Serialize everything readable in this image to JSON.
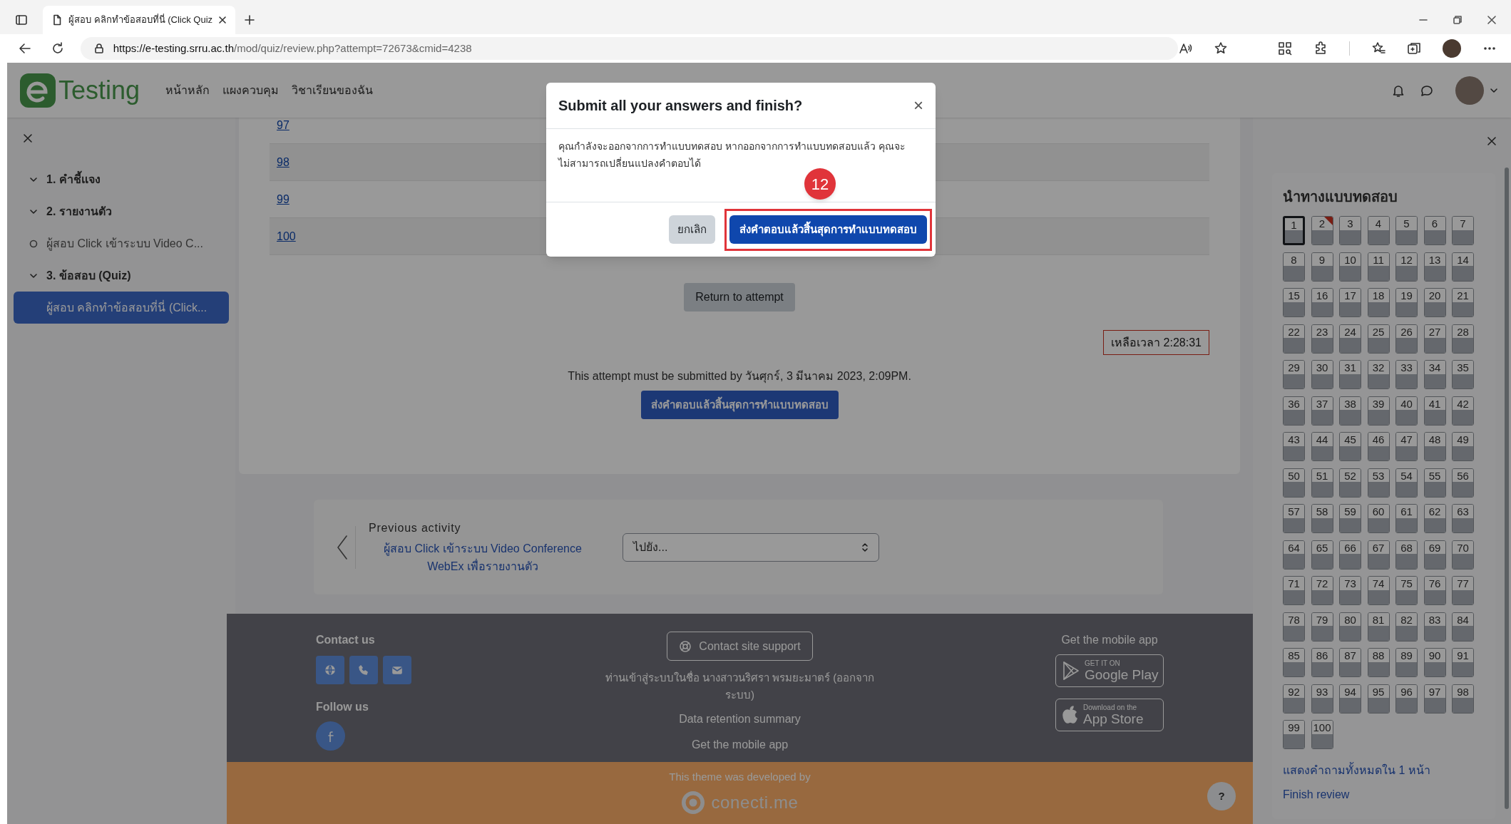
{
  "browser": {
    "tab_title": "ผู้สอบ คลิกทำข้อสอบที่นี่ (Click Quiz",
    "url_host": "https://e-testing.srru.ac.th",
    "url_path": "/mod/quiz/review.php?attempt=72673&cmid=4238"
  },
  "header": {
    "logo_text": "Testing",
    "nav": [
      "หน้าหลัก",
      "แผงควบคุม",
      "วิชาเรียนของฉัน"
    ]
  },
  "sidebar": {
    "items": [
      {
        "kind": "section",
        "label": "1. คำชี้แจง",
        "expanded": true,
        "selected": false
      },
      {
        "kind": "section",
        "label": "2. รายงานตัว",
        "expanded": true,
        "selected": false
      },
      {
        "kind": "activity",
        "label": "ผู้สอบ Click เข้าระบบ Video C...",
        "selected": false
      },
      {
        "kind": "section",
        "label": "3. ข้อสอบ (Quiz)",
        "expanded": true,
        "selected": false
      },
      {
        "kind": "activity",
        "label": "ผู้สอบ คลิกทำข้อสอบที่นี่ (Click...",
        "selected": true
      }
    ]
  },
  "review": {
    "question_links": [
      "97",
      "98",
      "99",
      "100"
    ],
    "return_button": "Return to attempt",
    "timer": "เหลือเวลา 2:28:31",
    "deadline_text": "This attempt must be submitted by วันศุกร์, 3 มีนาคม 2023, 2:09PM.",
    "submit_button": "ส่งคำตอบแล้วสิ้นสุดการทำแบบทดสอบ"
  },
  "activity_nav": {
    "label": "Previous activity",
    "link": "ผู้สอบ Click เข้าระบบ Video Conference WebEx เพื่อรายงานตัว",
    "jump_select": {
      "value": "ไปยัง..."
    }
  },
  "footer": {
    "contact_heading": "Contact us",
    "follow_heading": "Follow us",
    "support_button": "Contact site support",
    "login_info": "ท่านเข้าสู่ระบบในชื่อ นางสาวนริศรา พรมยะมาตร์ (ออกจากระบบ)",
    "links": [
      "Data retention summary",
      "Get the mobile app"
    ],
    "app_heading": "Get the mobile app",
    "store_badges": [
      {
        "kind": "google",
        "small": "GET IT ON",
        "big": "Google Play"
      },
      {
        "kind": "apple",
        "small": "Download on the",
        "big": "App Store"
      }
    ],
    "theme_credit": "This theme was developed by",
    "brand": "conecti.me",
    "help_button": "?"
  },
  "quiz_nav": {
    "title": "นำทางแบบทดสอบ",
    "questions": [
      {
        "label": "1",
        "selected": true,
        "flagged": false
      },
      {
        "label": "2",
        "selected": false,
        "flagged": true
      },
      {
        "label": "3",
        "selected": false,
        "flagged": false
      },
      {
        "label": "4",
        "selected": false,
        "flagged": false
      },
      {
        "label": "5",
        "selected": false,
        "flagged": false
      },
      {
        "label": "6",
        "selected": false,
        "flagged": false
      },
      {
        "label": "7",
        "selected": false,
        "flagged": false
      },
      {
        "label": "8",
        "selected": false,
        "flagged": false
      },
      {
        "label": "9",
        "selected": false,
        "flagged": false
      },
      {
        "label": "10",
        "selected": false,
        "flagged": false
      },
      {
        "label": "11",
        "selected": false,
        "flagged": false
      },
      {
        "label": "12",
        "selected": false,
        "flagged": false
      },
      {
        "label": "13",
        "selected": false,
        "flagged": false
      },
      {
        "label": "14",
        "selected": false,
        "flagged": false
      },
      {
        "label": "15",
        "selected": false,
        "flagged": false
      },
      {
        "label": "16",
        "selected": false,
        "flagged": false
      },
      {
        "label": "17",
        "selected": false,
        "flagged": false
      },
      {
        "label": "18",
        "selected": false,
        "flagged": false
      },
      {
        "label": "19",
        "selected": false,
        "flagged": false
      },
      {
        "label": "20",
        "selected": false,
        "flagged": false
      },
      {
        "label": "21",
        "selected": false,
        "flagged": false
      },
      {
        "label": "22",
        "selected": false,
        "flagged": false
      },
      {
        "label": "23",
        "selected": false,
        "flagged": false
      },
      {
        "label": "24",
        "selected": false,
        "flagged": false
      },
      {
        "label": "25",
        "selected": false,
        "flagged": false
      },
      {
        "label": "26",
        "selected": false,
        "flagged": false
      },
      {
        "label": "27",
        "selected": false,
        "flagged": false
      },
      {
        "label": "28",
        "selected": false,
        "flagged": false
      },
      {
        "label": "29",
        "selected": false,
        "flagged": false
      },
      {
        "label": "30",
        "selected": false,
        "flagged": false
      },
      {
        "label": "31",
        "selected": false,
        "flagged": false
      },
      {
        "label": "32",
        "selected": false,
        "flagged": false
      },
      {
        "label": "33",
        "selected": false,
        "flagged": false
      },
      {
        "label": "34",
        "selected": false,
        "flagged": false
      },
      {
        "label": "35",
        "selected": false,
        "flagged": false
      },
      {
        "label": "36",
        "selected": false,
        "flagged": false
      },
      {
        "label": "37",
        "selected": false,
        "flagged": false
      },
      {
        "label": "38",
        "selected": false,
        "flagged": false
      },
      {
        "label": "39",
        "selected": false,
        "flagged": false
      },
      {
        "label": "40",
        "selected": false,
        "flagged": false
      },
      {
        "label": "41",
        "selected": false,
        "flagged": false
      },
      {
        "label": "42",
        "selected": false,
        "flagged": false
      },
      {
        "label": "43",
        "selected": false,
        "flagged": false
      },
      {
        "label": "44",
        "selected": false,
        "flagged": false
      },
      {
        "label": "45",
        "selected": false,
        "flagged": false
      },
      {
        "label": "46",
        "selected": false,
        "flagged": false
      },
      {
        "label": "47",
        "selected": false,
        "flagged": false
      },
      {
        "label": "48",
        "selected": false,
        "flagged": false
      },
      {
        "label": "49",
        "selected": false,
        "flagged": false
      },
      {
        "label": "50",
        "selected": false,
        "flagged": false
      },
      {
        "label": "51",
        "selected": false,
        "flagged": false
      },
      {
        "label": "52",
        "selected": false,
        "flagged": false
      },
      {
        "label": "53",
        "selected": false,
        "flagged": false
      },
      {
        "label": "54",
        "selected": false,
        "flagged": false
      },
      {
        "label": "55",
        "selected": false,
        "flagged": false
      },
      {
        "label": "56",
        "selected": false,
        "flagged": false
      },
      {
        "label": "57",
        "selected": false,
        "flagged": false
      },
      {
        "label": "58",
        "selected": false,
        "flagged": false
      },
      {
        "label": "59",
        "selected": false,
        "flagged": false
      },
      {
        "label": "60",
        "selected": false,
        "flagged": false
      },
      {
        "label": "61",
        "selected": false,
        "flagged": false
      },
      {
        "label": "62",
        "selected": false,
        "flagged": false
      },
      {
        "label": "63",
        "selected": false,
        "flagged": false
      },
      {
        "label": "64",
        "selected": false,
        "flagged": false
      },
      {
        "label": "65",
        "selected": false,
        "flagged": false
      },
      {
        "label": "66",
        "selected": false,
        "flagged": false
      },
      {
        "label": "67",
        "selected": false,
        "flagged": false
      },
      {
        "label": "68",
        "selected": false,
        "flagged": false
      },
      {
        "label": "69",
        "selected": false,
        "flagged": false
      },
      {
        "label": "70",
        "selected": false,
        "flagged": false
      },
      {
        "label": "71",
        "selected": false,
        "flagged": false
      },
      {
        "label": "72",
        "selected": false,
        "flagged": false
      },
      {
        "label": "73",
        "selected": false,
        "flagged": false
      },
      {
        "label": "74",
        "selected": false,
        "flagged": false
      },
      {
        "label": "75",
        "selected": false,
        "flagged": false
      },
      {
        "label": "76",
        "selected": false,
        "flagged": false
      },
      {
        "label": "77",
        "selected": false,
        "flagged": false
      },
      {
        "label": "78",
        "selected": false,
        "flagged": false
      },
      {
        "label": "79",
        "selected": false,
        "flagged": false
      },
      {
        "label": "80",
        "selected": false,
        "flagged": false
      },
      {
        "label": "81",
        "selected": false,
        "flagged": false
      },
      {
        "label": "82",
        "selected": false,
        "flagged": false
      },
      {
        "label": "83",
        "selected": false,
        "flagged": false
      },
      {
        "label": "84",
        "selected": false,
        "flagged": false
      },
      {
        "label": "85",
        "selected": false,
        "flagged": false
      },
      {
        "label": "86",
        "selected": false,
        "flagged": false
      },
      {
        "label": "87",
        "selected": false,
        "flagged": false
      },
      {
        "label": "88",
        "selected": false,
        "flagged": false
      },
      {
        "label": "89",
        "selected": false,
        "flagged": false
      },
      {
        "label": "90",
        "selected": false,
        "flagged": false
      },
      {
        "label": "91",
        "selected": false,
        "flagged": false
      },
      {
        "label": "92",
        "selected": false,
        "flagged": false
      },
      {
        "label": "93",
        "selected": false,
        "flagged": false
      },
      {
        "label": "94",
        "selected": false,
        "flagged": false
      },
      {
        "label": "95",
        "selected": false,
        "flagged": false
      },
      {
        "label": "96",
        "selected": false,
        "flagged": false
      },
      {
        "label": "97",
        "selected": false,
        "flagged": false
      },
      {
        "label": "98",
        "selected": false,
        "flagged": false
      },
      {
        "label": "99",
        "selected": false,
        "flagged": false
      },
      {
        "label": "100",
        "selected": false,
        "flagged": false
      }
    ],
    "show_all_link": "แสดงคำถามทั้งหมดใน 1 หน้า",
    "finish_link": "Finish review"
  },
  "modal": {
    "title": "Submit all your answers and finish?",
    "close": "×",
    "body": "คุณกำลังจะออกจากการทำแบบทดสอบ หากออกจากการทำแบบทดสอบแล้ว คุณจะไม่สามารถเปลี่ยนแปลงคำตอบได้",
    "cancel_button": "ยกเลิก",
    "submit_button": "ส่งคำตอบแล้วสิ้นสุดการทำแบบทดสอบ"
  },
  "annotation": {
    "step": "12",
    "highlight_submit": true
  }
}
